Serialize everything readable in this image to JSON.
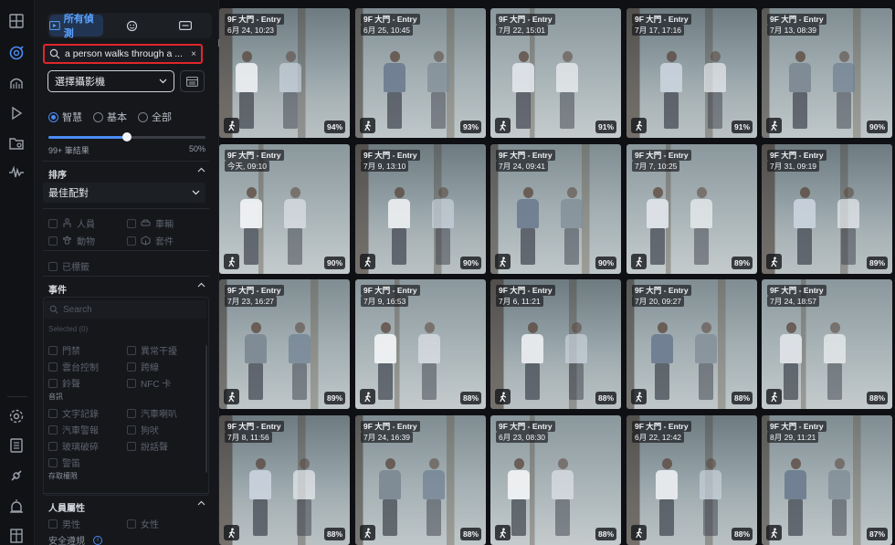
{
  "rail": {
    "icons": [
      "grid-icon",
      "ai-search-icon",
      "map-icon",
      "play-icon",
      "folder-video-icon",
      "waveform-icon",
      "settings-icon",
      "list-icon",
      "plugin-icon",
      "alarm-icon",
      "building-icon"
    ]
  },
  "modes": {
    "active_label": "所有偵測"
  },
  "search": {
    "value": "a person walks through a ...",
    "clear": "×"
  },
  "camera_select": {
    "label": "選擇攝影機"
  },
  "match_modes": [
    {
      "label": "智慧",
      "selected": true
    },
    {
      "label": "基本",
      "selected": false
    },
    {
      "label": "全部",
      "selected": false
    }
  ],
  "threshold": {
    "left_label": "99+ 筆結果",
    "right_label": "50%",
    "fraction": 0.5
  },
  "sort": {
    "header": "排序",
    "value": "最佳配對"
  },
  "object_types": [
    {
      "label": "人員",
      "icon": "person-icon"
    },
    {
      "label": "車輛",
      "icon": "car-icon"
    },
    {
      "label": "動物",
      "icon": "paw-icon"
    },
    {
      "label": "套件",
      "icon": "package-icon"
    }
  ],
  "tagged_label": "已標籤",
  "events": {
    "header": "事件",
    "search_placeholder": "Search",
    "selected_count": "Selected (0)",
    "items_left": [
      "門禁",
      "雲台控制",
      "鈴聲"
    ],
    "items_right": [
      "異常干擾",
      "跨線",
      "NFC 卡"
    ],
    "audio_label": "音訊",
    "audio_left": [
      "文字記錄",
      "汽車警報",
      "玻璃破碎",
      "警笛"
    ],
    "audio_right": [
      "汽車喇叭",
      "狗吠",
      "說話聲"
    ],
    "access_label": "存取權限"
  },
  "attributes": {
    "header": "人員屬性",
    "male": "男性",
    "female": "女性",
    "safety": "安全遵規",
    "info": "i"
  },
  "results": [
    {
      "camera": "9F 大門 - Entry",
      "time": "6月 24, 10:23",
      "score": "94%"
    },
    {
      "camera": "9F 大門 - Entry",
      "time": "6月 25, 10:45",
      "score": "93%"
    },
    {
      "camera": "9F 大門 - Entry",
      "time": "7月 22, 15:01",
      "score": "91%"
    },
    {
      "camera": "9F 大門 - Entry",
      "time": "7月 17, 17:16",
      "score": "91%"
    },
    {
      "camera": "9F 大門 - Entry",
      "time": "7月 13, 08:39",
      "score": "90%"
    },
    {
      "camera": "9F 大門 - Entry",
      "time": "今天, 09:10",
      "score": "90%"
    },
    {
      "camera": "9F 大門 - Entry",
      "time": "7月 9, 13:10",
      "score": "90%"
    },
    {
      "camera": "9F 大門 - Entry",
      "time": "7月 24, 09:41",
      "score": "90%"
    },
    {
      "camera": "9F 大門 - Entry",
      "time": "7月 7, 10:25",
      "score": "89%"
    },
    {
      "camera": "9F 大門 - Entry",
      "time": "7月 31, 09:19",
      "score": "89%"
    },
    {
      "camera": "9F 大門 - Entry",
      "time": "7月 23, 16:27",
      "score": "89%"
    },
    {
      "camera": "9F 大門 - Entry",
      "time": "7月 9, 16:53",
      "score": "88%"
    },
    {
      "camera": "9F 大門 - Entry",
      "time": "7月 6, 11:21",
      "score": "88%"
    },
    {
      "camera": "9F 大門 - Entry",
      "time": "7月 20, 09:27",
      "score": "88%"
    },
    {
      "camera": "9F 大門 - Entry",
      "time": "7月 24, 18:57",
      "score": "88%"
    },
    {
      "camera": "9F 大門 - Entry",
      "time": "7月 8, 11:56",
      "score": "88%"
    },
    {
      "camera": "9F 大門 - Entry",
      "time": "7月 24, 16:39",
      "score": "88%"
    },
    {
      "camera": "9F 大門 - Entry",
      "time": "6月 23, 08:30",
      "score": "88%"
    },
    {
      "camera": "9F 大門 - Entry",
      "time": "6月 22, 12:42",
      "score": "88%"
    },
    {
      "camera": "9F 大門 - Entry",
      "time": "8月 29, 11:21",
      "score": "87%"
    }
  ],
  "colors": {
    "accent": "#4b8cf5",
    "highlight_border": "#e0262b"
  }
}
